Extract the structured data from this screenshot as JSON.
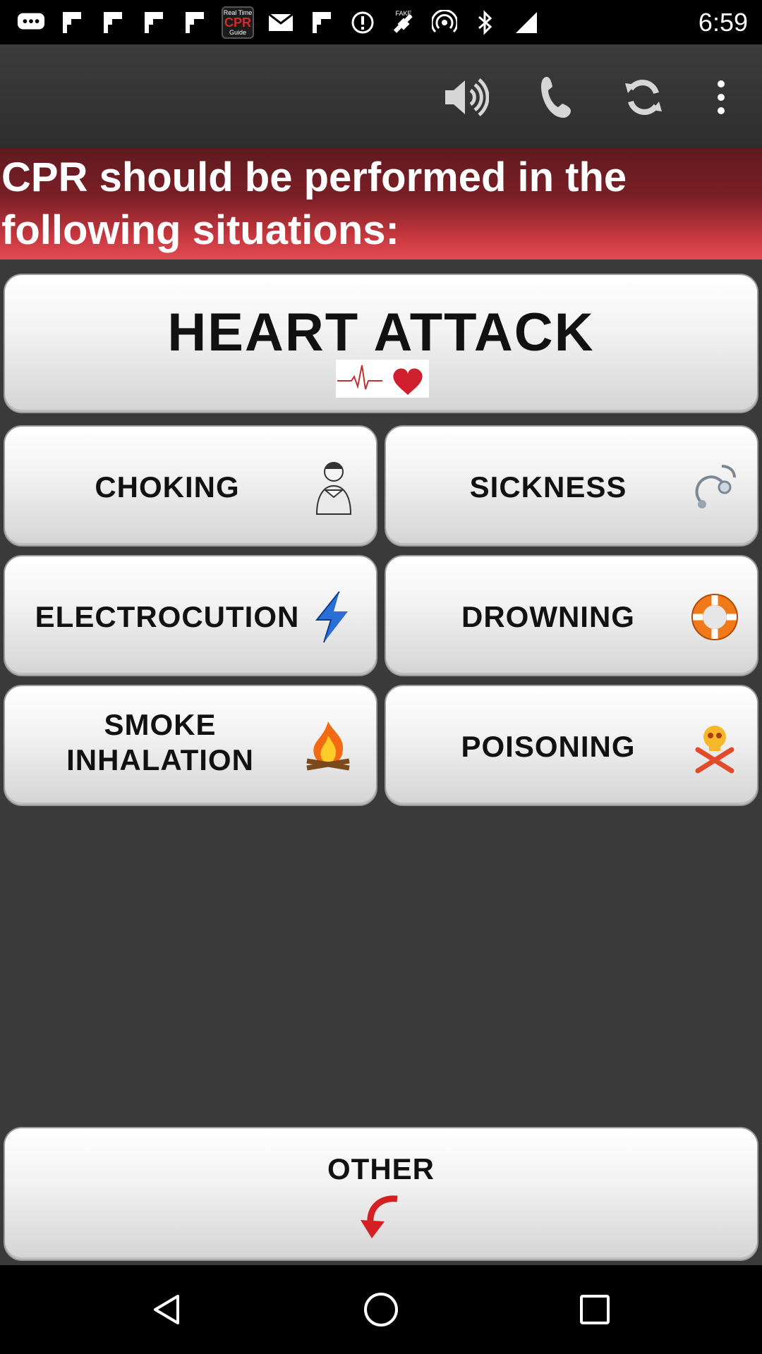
{
  "status_bar": {
    "app_icon_top": "Real Time",
    "app_icon_main": "CPR",
    "app_icon_bottom": "Guide",
    "time": "6:59",
    "icons": [
      "chat-icon",
      "flipboard-icon",
      "flipboard-icon",
      "flipboard-icon",
      "flipboard-icon",
      "cpr-app-icon",
      "mail-icon",
      "flipboard-icon",
      "alert-icon",
      "fake-gps-icon",
      "hotspot-icon",
      "bluetooth-icon",
      "signal-icon"
    ]
  },
  "toolbar": {
    "icons": [
      "speaker-icon",
      "phone-icon",
      "refresh-icon",
      "more-icon"
    ]
  },
  "banner": {
    "text": "CPR should be performed in the following situations:"
  },
  "situations": {
    "heart_attack": "HEART ATTACK",
    "choking": "CHOKING",
    "sickness": "SICKNESS",
    "electrocution": "ELECTROCUTION",
    "drowning": "DROWNING",
    "smoke_inhalation": "SMOKE INHALATION",
    "poisoning": "POISONING",
    "other": "OTHER"
  },
  "colors": {
    "banner_dark": "#5f1a1f",
    "banner_light": "#e04c53",
    "background": "#3a3a3a",
    "accent_red": "#d42a2a"
  }
}
